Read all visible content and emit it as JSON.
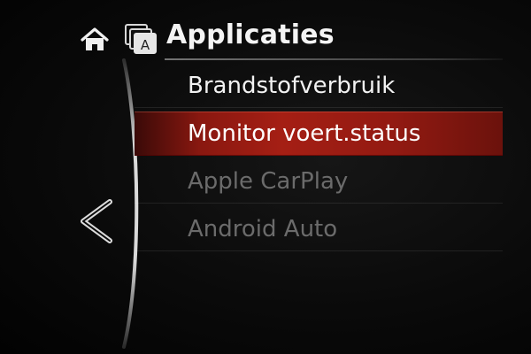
{
  "header": {
    "title": "Applicaties",
    "home_icon": "home-icon",
    "app_icon": "applications-icon",
    "app_icon_letter": "A"
  },
  "menu": {
    "items": [
      {
        "label": "Brandstofverbruik",
        "state": "enabled"
      },
      {
        "label": "Monitor voert.status",
        "state": "selected"
      },
      {
        "label": "Apple CarPlay",
        "state": "disabled"
      },
      {
        "label": "Android Auto",
        "state": "disabled"
      }
    ]
  },
  "navigation": {
    "back_icon": "chevron-left-icon"
  },
  "colors": {
    "background": "#000000",
    "selection": "#a51f14",
    "text": "#f2f2f2",
    "disabled_text": "#6b6b6b"
  }
}
